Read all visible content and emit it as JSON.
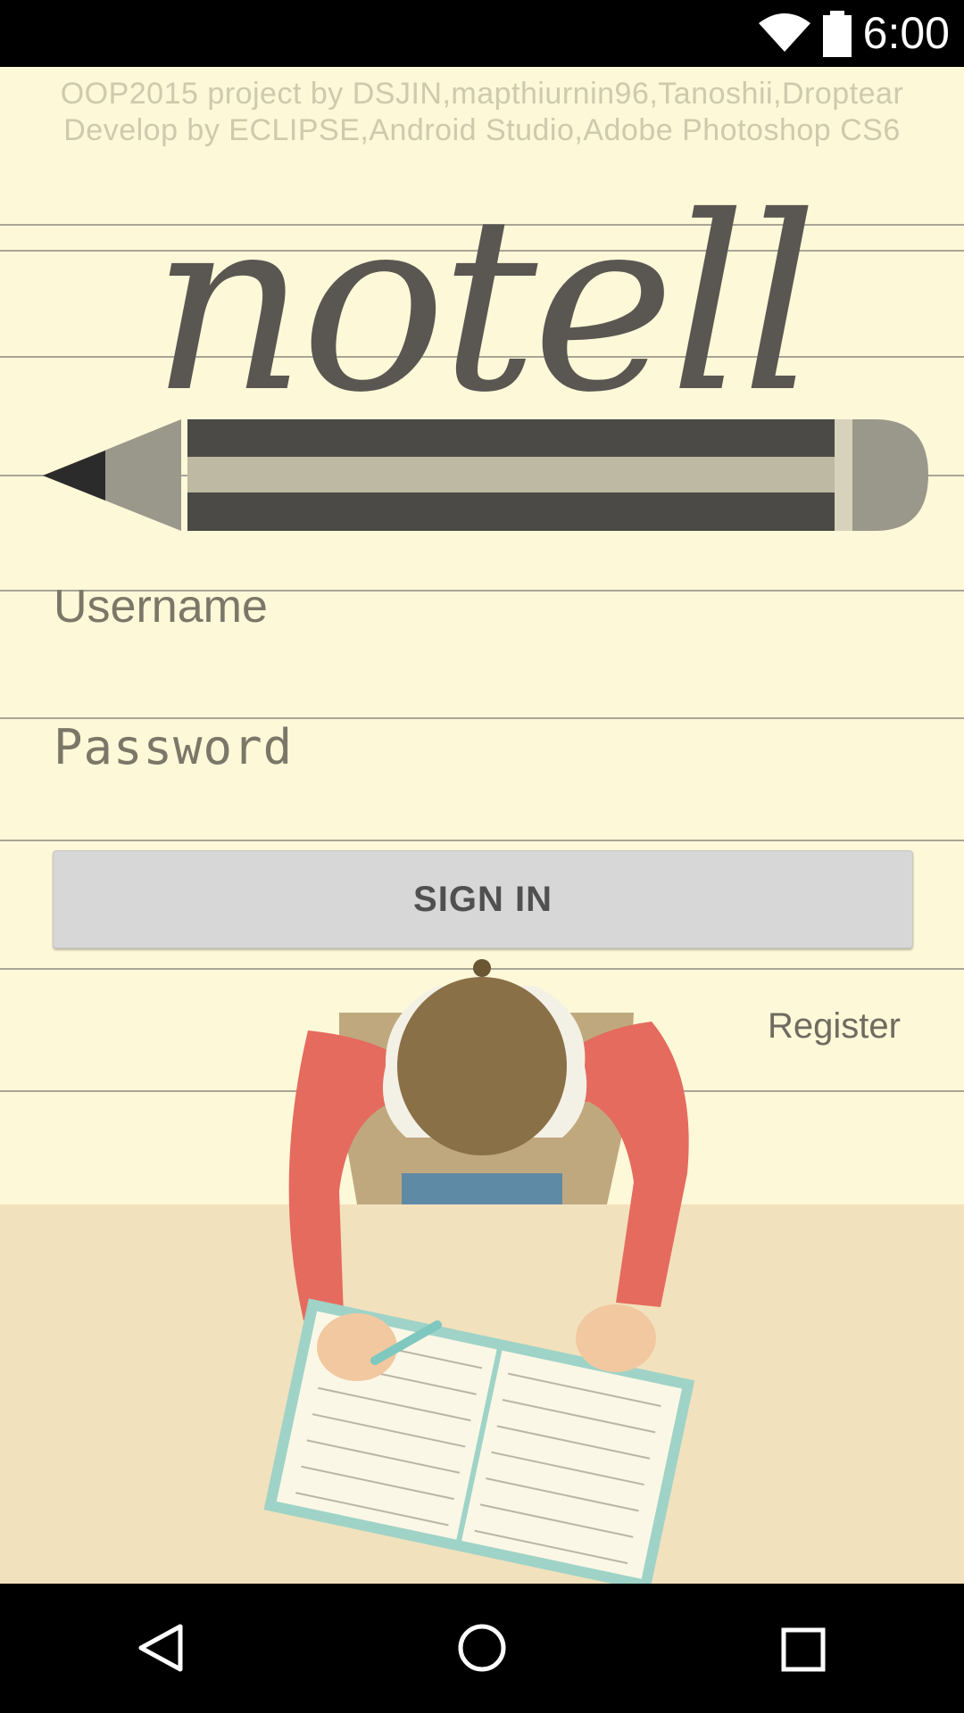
{
  "status_bar": {
    "time": "6:00"
  },
  "app": {
    "credits_line1": "OOP2015 project by DSJIN,mapthiurnin96,Tanoshii,Droptear",
    "credits_line2": "Develop by ECLIPSE,Android Studio,Adobe Photoshop CS6",
    "logo_text": "notell",
    "username_placeholder": "Username",
    "password_placeholder": "Password",
    "sign_in_label": "SIGN IN",
    "register_label": "Register"
  },
  "icons": {
    "wifi": "wifi-icon",
    "battery": "battery-icon",
    "back": "back-icon",
    "home": "home-icon",
    "recents": "recents-icon"
  },
  "colors": {
    "background": "#fdf8d8",
    "button": "#d7d7d7",
    "desk": "#f2e1bd"
  }
}
